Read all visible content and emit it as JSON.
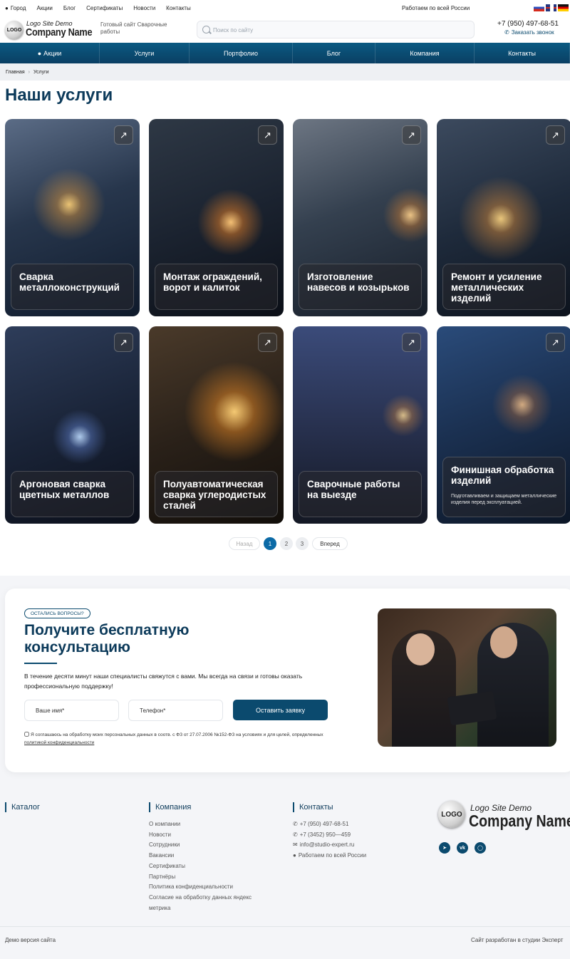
{
  "topbar": {
    "links": [
      "Город",
      "Акции",
      "Блог",
      "Сертификаты",
      "Новости",
      "Контакты"
    ],
    "region": "Работаем по всей России",
    "flags": [
      "ru",
      "uk",
      "de"
    ]
  },
  "header": {
    "logo_badge": "LOGO",
    "logo_line1": "Logo Site Demo",
    "logo_line2": "Company Name",
    "tagline": "Готовый сайт Сварочные работы",
    "search_placeholder": "Поиск по сайту",
    "phone": "+7 (950) 497-68-51",
    "callback": "Заказать звонок"
  },
  "nav": [
    {
      "label": "Акции",
      "icon": "percent-icon"
    },
    {
      "label": "Услуги"
    },
    {
      "label": "Портфолио"
    },
    {
      "label": "Блог"
    },
    {
      "label": "Компания"
    },
    {
      "label": "Контакты"
    }
  ],
  "breadcrumb": [
    "Главная",
    "Услуги"
  ],
  "page_title": "Наши услуги",
  "services": [
    {
      "name": "Сварка металлоконструкций"
    },
    {
      "name": "Монтаж ограждений, ворот и калиток"
    },
    {
      "name": "Изготовление навесов и козырьков"
    },
    {
      "name": "Ремонт и усиление металлических изделий"
    },
    {
      "name": "Аргоновая сварка цветных металлов"
    },
    {
      "name": "Полуавтоматическая сварка углеродистых сталей"
    },
    {
      "name": "Сварочные работы на выезде"
    },
    {
      "name": "Финишная обработка изделий",
      "desc": "Подготавливаем и защищаем металлические изделия перед эксплуатацией."
    }
  ],
  "pagination": {
    "prev": "Назад",
    "pages": [
      "1",
      "2",
      "3"
    ],
    "current": "1",
    "next": "Вперед"
  },
  "consult": {
    "pill": "ОСТАЛИСЬ ВОПРОСЫ?",
    "title": "Получите бесплатную консультацию",
    "lead": "В течение десяти минут наши специалисты свяжутся с вами. Мы всегда на связи и готовы оказать профессиональную поддержку!",
    "name_placeholder": "Ваше имя*",
    "phone_placeholder": "Телефон*",
    "submit": "Оставить заявку",
    "agree_text": "Я соглашаюсь на обработку моих персональных данных в соотв. с ФЗ от 27.07.2006 №152-ФЗ на условиях и для целей, определенных",
    "agree_link": "политикой конфиденциальности"
  },
  "footer": {
    "catalog_title": "Каталог",
    "company_title": "Компания",
    "company_links": [
      "О компании",
      "Новости",
      "Сотрудники",
      "Вакансии",
      "Сертификаты",
      "Партнёры",
      "Политика конфиденциальности",
      "Согласие на обработку данных яндекс метрика"
    ],
    "contacts_title": "Контакты",
    "contacts": [
      {
        "icon": "phone-icon",
        "text": "+7 (950) 497-68-51"
      },
      {
        "icon": "phone-icon",
        "text": "+7 (3452) 950—459"
      },
      {
        "icon": "mail-icon",
        "text": "info@studio-expert.ru"
      },
      {
        "icon": "location-icon",
        "text": "Работаем по всей России"
      }
    ],
    "logo_badge": "LOGO",
    "logo_line1": "Logo Site Demo",
    "logo_line2": "Company Name",
    "social": [
      "telegram-icon",
      "vk-icon",
      "chat-icon"
    ],
    "demo": "Демо версия сайта",
    "developer": "Сайт разработан в студии Эксперт"
  },
  "colors": {
    "primary": "#0b4a6e",
    "nav": "#0a4f76",
    "accent": "#0b6aa6"
  }
}
